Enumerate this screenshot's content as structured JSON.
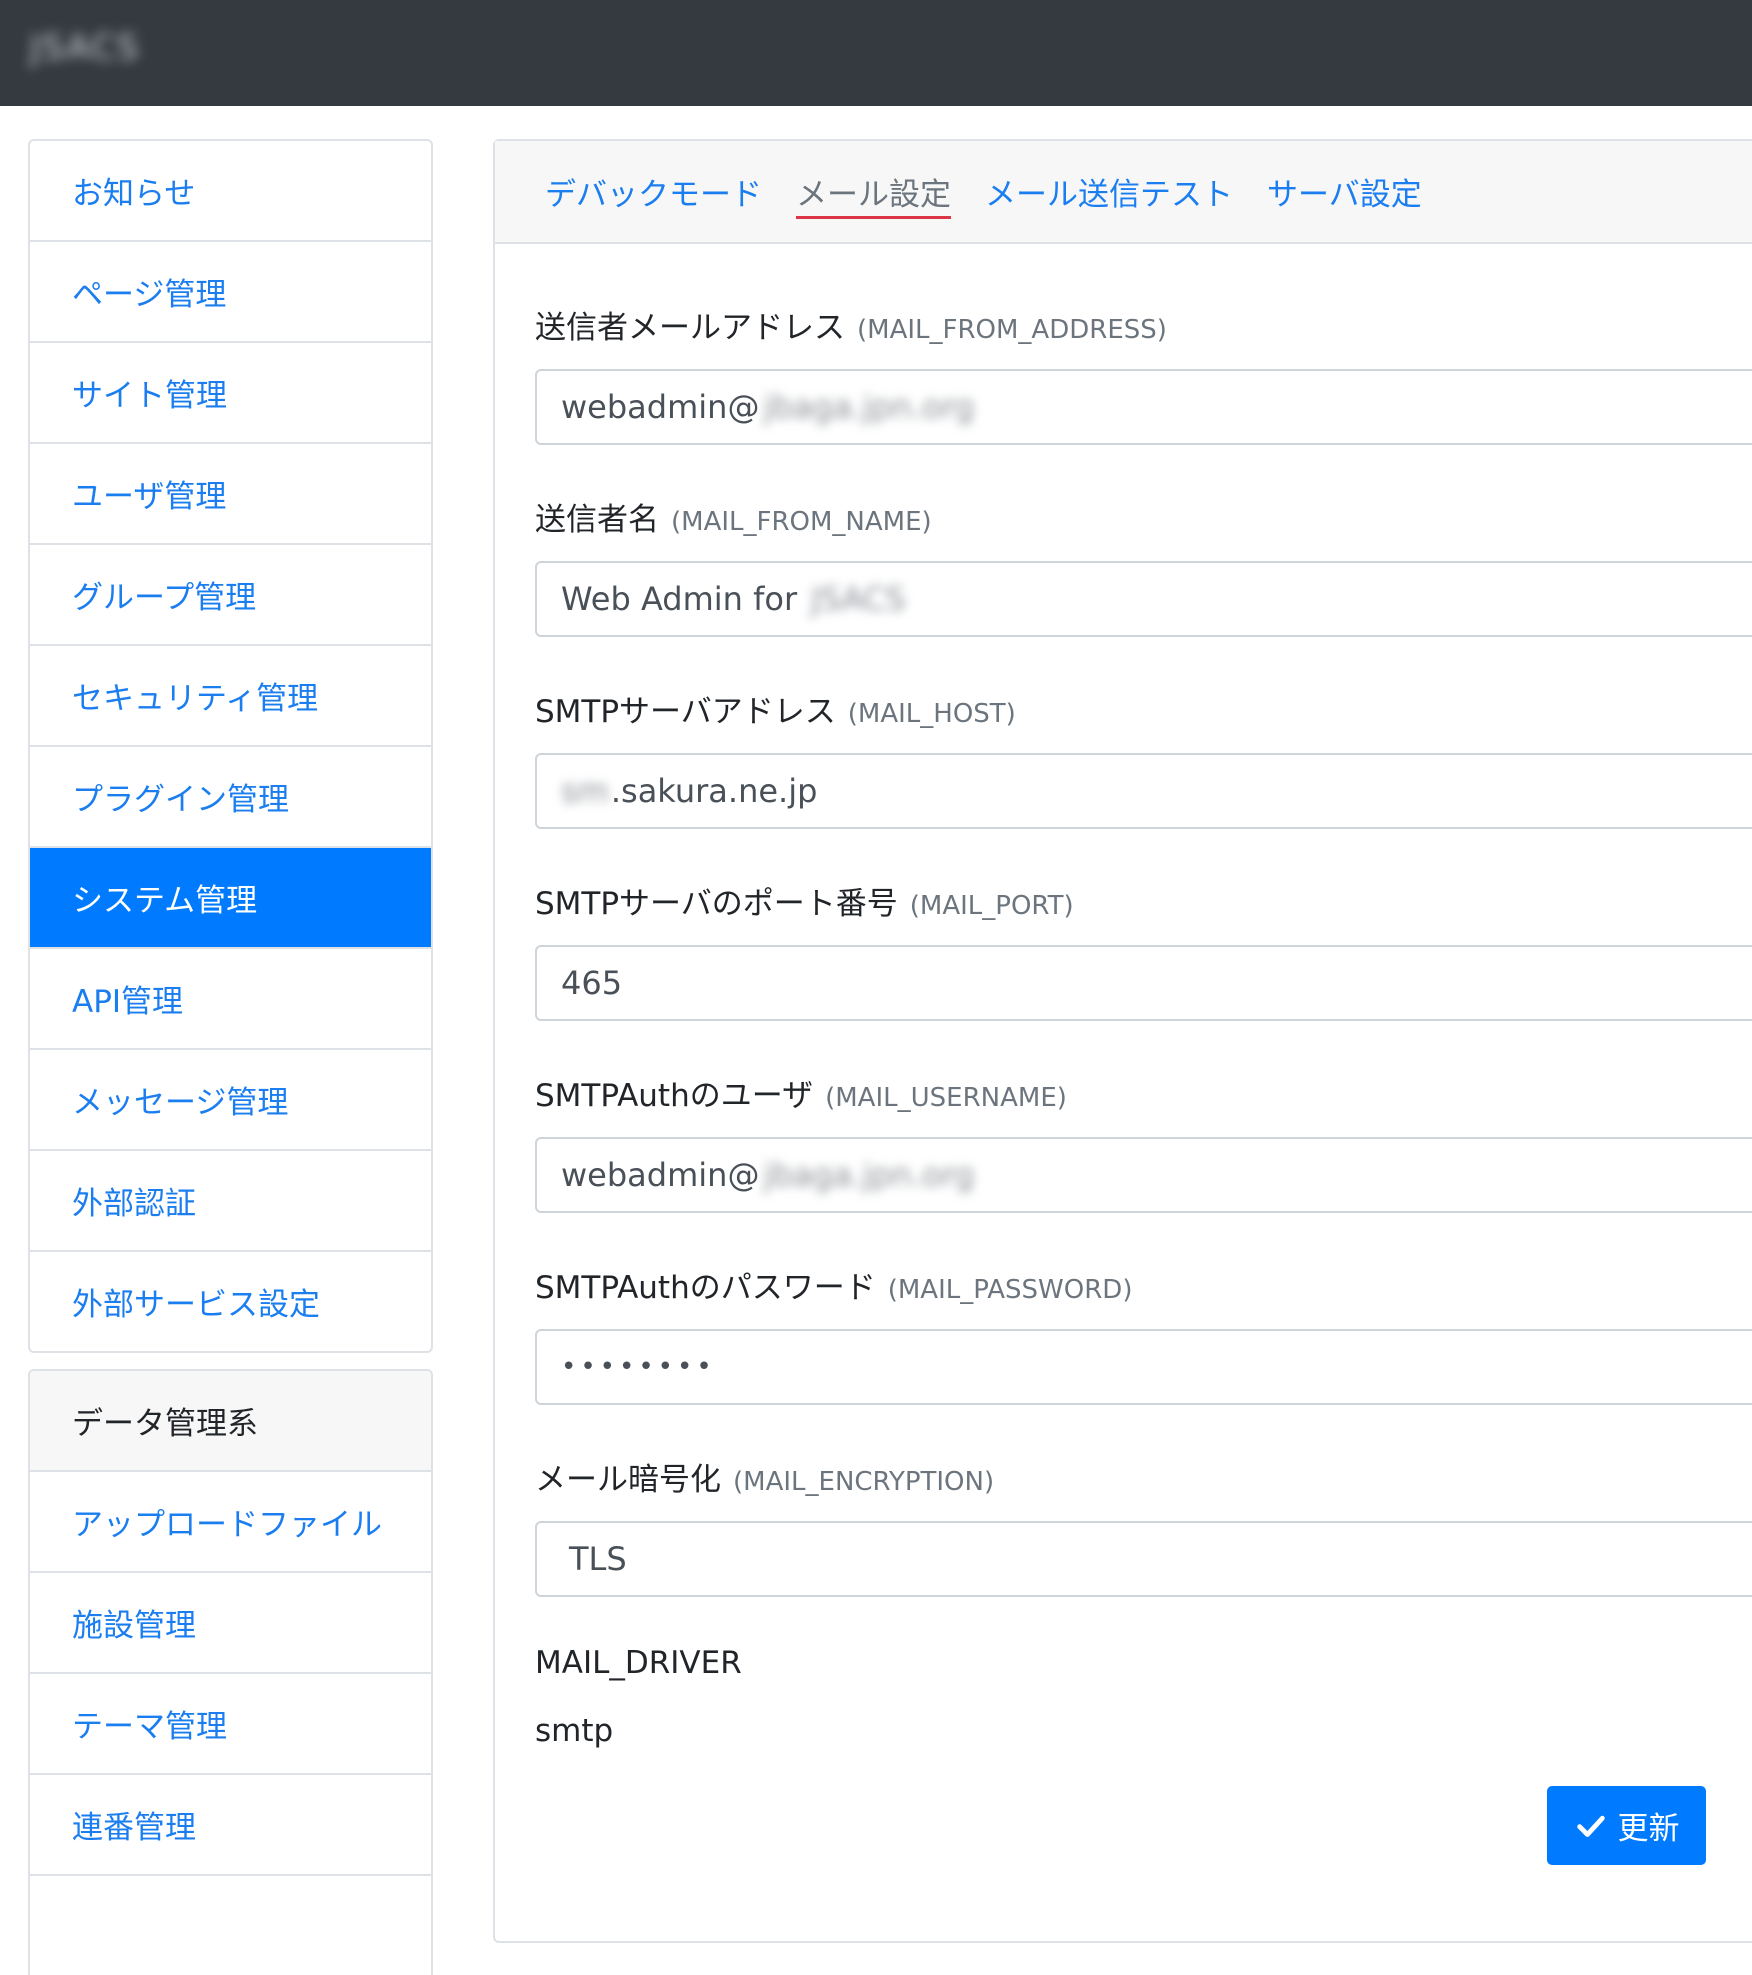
{
  "header": {
    "brand": "JSACS"
  },
  "sidebar": {
    "items": [
      {
        "label": "お知らせ",
        "active": false
      },
      {
        "label": "ページ管理",
        "active": false
      },
      {
        "label": "サイト管理",
        "active": false
      },
      {
        "label": "ユーザ管理",
        "active": false
      },
      {
        "label": "グループ管理",
        "active": false
      },
      {
        "label": "セキュリティ管理",
        "active": false
      },
      {
        "label": "プラグイン管理",
        "active": false
      },
      {
        "label": "システム管理",
        "active": true
      },
      {
        "label": "API管理",
        "active": false
      },
      {
        "label": "メッセージ管理",
        "active": false
      },
      {
        "label": "外部認証",
        "active": false
      },
      {
        "label": "外部サービス設定",
        "active": false
      }
    ],
    "data_section": {
      "heading": "データ管理系",
      "items": [
        {
          "label": "アップロードファイル"
        },
        {
          "label": "施設管理"
        },
        {
          "label": "テーマ管理"
        },
        {
          "label": "連番管理"
        }
      ]
    }
  },
  "tabs": [
    {
      "label": "デバックモード",
      "active": false
    },
    {
      "label": "メール設定",
      "active": true
    },
    {
      "label": "メール送信テスト",
      "active": false
    },
    {
      "label": "サーバ設定",
      "active": false
    }
  ],
  "form": {
    "from_address": {
      "label": "送信者メールアドレス",
      "code": "(MAIL_FROM_ADDRESS)",
      "value": "webadmin@",
      "redacted": "jbaga.jpn.org"
    },
    "from_name": {
      "label": "送信者名",
      "code": "(MAIL_FROM_NAME)",
      "value": "Web Admin for",
      "redacted": "JSACS"
    },
    "host": {
      "label": "SMTPサーバアドレス",
      "code": "(MAIL_HOST)",
      "redacted": "sm",
      "value": ".sakura.ne.jp"
    },
    "port": {
      "label": "SMTPサーバのポート番号",
      "code": "(MAIL_PORT)",
      "value": "465"
    },
    "username": {
      "label": "SMTPAuthのユーザ",
      "code": "(MAIL_USERNAME)",
      "value": "webadmin@",
      "redacted": "jbaga.jpn.org"
    },
    "password": {
      "label": "SMTPAuthのパスワード",
      "code": "(MAIL_PASSWORD)",
      "value": "••••••••"
    },
    "encryption": {
      "label": "メール暗号化",
      "code": "(MAIL_ENCRYPTION)",
      "value": "TLS"
    },
    "driver": {
      "label": "MAIL_DRIVER",
      "value": "smtp"
    }
  },
  "actions": {
    "update_label": "更新"
  },
  "colors": {
    "primary": "#007bff",
    "link": "#1b7ef0",
    "topbar": "#343a40",
    "active_tab_underline": "#dc3545"
  }
}
